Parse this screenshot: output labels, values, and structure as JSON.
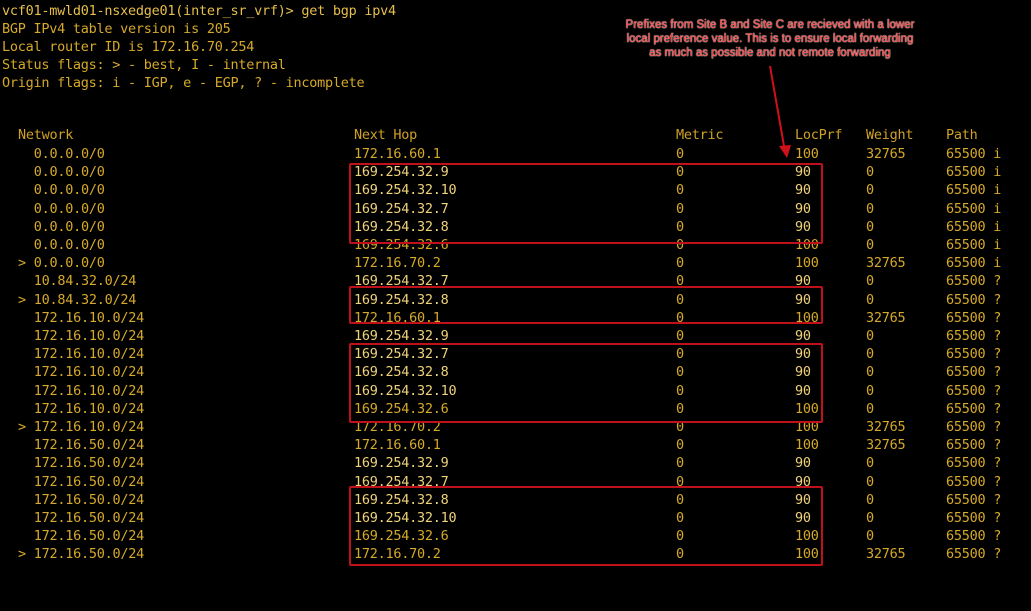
{
  "terminal": {
    "prompt": "vcf01-mwld01-nsxedge01(inter_sr_vrf)> get bgp ipv4",
    "info": [
      "BGP IPv4 table version is 205",
      "Local router ID is 172.16.70.254",
      "Status flags: > - best, I - internal",
      "Origin flags: i - IGP, e - EGP, ? - incomplete"
    ],
    "columns": {
      "network": "Network",
      "next_hop": "Next Hop",
      "metric": "Metric",
      "locprf": "LocPrf",
      "weight": "Weight",
      "path": "Path"
    },
    "rows": [
      {
        "net": "  0.0.0.0/0",
        "hop": "172.16.60.1",
        "metric": "0",
        "locprf": "100",
        "weight": "32765",
        "path": "65500 i"
      },
      {
        "net": "  0.0.0.0/0",
        "hop": "169.254.32.9",
        "metric": "0",
        "locprf": "90",
        "weight": "0",
        "path": "65500 i"
      },
      {
        "net": "  0.0.0.0/0",
        "hop": "169.254.32.10",
        "metric": "0",
        "locprf": "90",
        "weight": "0",
        "path": "65500 i"
      },
      {
        "net": "  0.0.0.0/0",
        "hop": "169.254.32.7",
        "metric": "0",
        "locprf": "90",
        "weight": "0",
        "path": "65500 i"
      },
      {
        "net": "  0.0.0.0/0",
        "hop": "169.254.32.8",
        "metric": "0",
        "locprf": "90",
        "weight": "0",
        "path": "65500 i"
      },
      {
        "net": "  0.0.0.0/0",
        "hop": "169.254.32.6",
        "metric": "0",
        "locprf": "100",
        "weight": "0",
        "path": "65500 i"
      },
      {
        "net": "> 0.0.0.0/0",
        "hop": "172.16.70.2",
        "metric": "0",
        "locprf": "100",
        "weight": "32765",
        "path": "65500 i"
      },
      {
        "net": "  10.84.32.0/24",
        "hop": "169.254.32.7",
        "metric": "0",
        "locprf": "90",
        "weight": "0",
        "path": "65500 ?"
      },
      {
        "net": "> 10.84.32.0/24",
        "hop": "169.254.32.8",
        "metric": "0",
        "locprf": "90",
        "weight": "0",
        "path": "65500 ?"
      },
      {
        "net": "  172.16.10.0/24",
        "hop": "172.16.60.1",
        "metric": "0",
        "locprf": "100",
        "weight": "32765",
        "path": "65500 ?"
      },
      {
        "net": "  172.16.10.0/24",
        "hop": "169.254.32.9",
        "metric": "0",
        "locprf": "90",
        "weight": "0",
        "path": "65500 ?"
      },
      {
        "net": "  172.16.10.0/24",
        "hop": "169.254.32.7",
        "metric": "0",
        "locprf": "90",
        "weight": "0",
        "path": "65500 ?"
      },
      {
        "net": "  172.16.10.0/24",
        "hop": "169.254.32.8",
        "metric": "0",
        "locprf": "90",
        "weight": "0",
        "path": "65500 ?"
      },
      {
        "net": "  172.16.10.0/24",
        "hop": "169.254.32.10",
        "metric": "0",
        "locprf": "90",
        "weight": "0",
        "path": "65500 ?"
      },
      {
        "net": "  172.16.10.0/24",
        "hop": "169.254.32.6",
        "metric": "0",
        "locprf": "100",
        "weight": "0",
        "path": "65500 ?"
      },
      {
        "net": "> 172.16.10.0/24",
        "hop": "172.16.70.2",
        "metric": "0",
        "locprf": "100",
        "weight": "32765",
        "path": "65500 ?"
      },
      {
        "net": "  172.16.50.0/24",
        "hop": "172.16.60.1",
        "metric": "0",
        "locprf": "100",
        "weight": "32765",
        "path": "65500 ?"
      },
      {
        "net": "  172.16.50.0/24",
        "hop": "169.254.32.9",
        "metric": "0",
        "locprf": "90",
        "weight": "0",
        "path": "65500 ?"
      },
      {
        "net": "  172.16.50.0/24",
        "hop": "169.254.32.7",
        "metric": "0",
        "locprf": "90",
        "weight": "0",
        "path": "65500 ?"
      },
      {
        "net": "  172.16.50.0/24",
        "hop": "169.254.32.8",
        "metric": "0",
        "locprf": "90",
        "weight": "0",
        "path": "65500 ?"
      },
      {
        "net": "  172.16.50.0/24",
        "hop": "169.254.32.10",
        "metric": "0",
        "locprf": "90",
        "weight": "0",
        "path": "65500 ?"
      },
      {
        "net": "  172.16.50.0/24",
        "hop": "169.254.32.6",
        "metric": "0",
        "locprf": "100",
        "weight": "0",
        "path": "65500 ?"
      },
      {
        "net": "> 172.16.50.0/24",
        "hop": "172.16.70.2",
        "metric": "0",
        "locprf": "100",
        "weight": "32765",
        "path": "65500 ?"
      }
    ]
  },
  "annotation": {
    "lines": [
      "Prefixes from Site B and Site C are recieved with a lower",
      "local preference value. This is to ensure local forwarding",
      "as much as possible and not remote forwarding"
    ],
    "color": "#ff3b3b"
  },
  "colors": {
    "background": "#000000",
    "text": "#d6a92a",
    "highlight": "#c0101a"
  }
}
